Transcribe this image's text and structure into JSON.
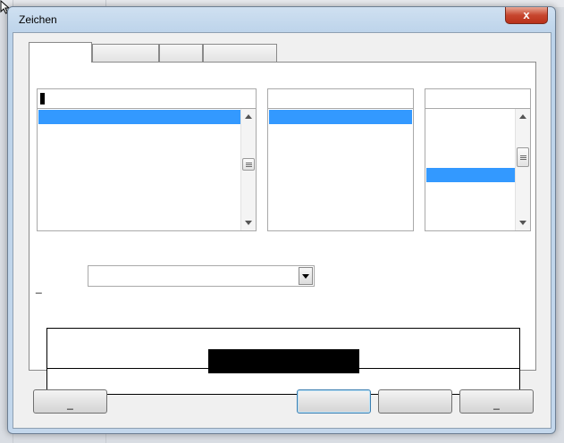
{
  "window": {
    "title": "Zeichen",
    "close_glyph": "x"
  },
  "tabs": [
    {
      "label": ""
    },
    {
      "label": ""
    },
    {
      "label": ""
    },
    {
      "label": ""
    }
  ],
  "font_list": {
    "input_value": "",
    "selected_item": ""
  },
  "style_list": {
    "selected_item": ""
  },
  "size_list": {
    "input_value": "",
    "selected_item": ""
  },
  "language": {
    "label": "_",
    "value": ""
  },
  "preview": {
    "text": ""
  },
  "buttons": {
    "help": "_",
    "ok": "",
    "cancel": "",
    "reset": "_"
  },
  "colors": {
    "selection": "#3399ff",
    "close": "#c7462e",
    "accent_border": "#3c7fb1"
  },
  "icons": [
    "cursor-arrow-icon",
    "close-icon",
    "scroll-up-icon",
    "scroll-down-icon",
    "dropdown-arrow-icon"
  ]
}
